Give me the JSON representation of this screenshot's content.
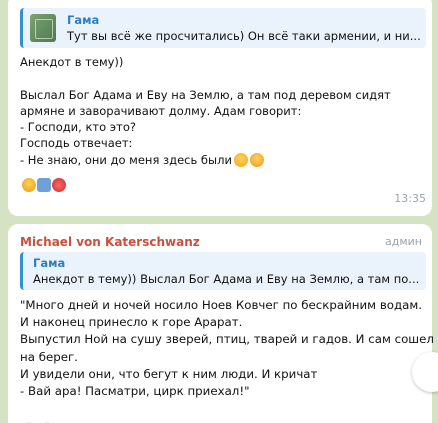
{
  "message1": {
    "reply": {
      "author": "Гама",
      "preview": "Тут вы всё же просчитались) Он всё таки армении, и ни..."
    },
    "text": "Анекдот в тему))\n\nВыслал Бог Адама и Еву на Землю, а там под деревом сидят\nармяне и заворачивают долму. Адам говорит:\n- Господи, кто это?\nГосподь отвечает:\n- Не знаю, они до меня здесь были",
    "inline_emoji": [
      "grinning-face-icon",
      "rofl-face-icon"
    ],
    "reactions": [
      "rofl-reaction-icon",
      "clapper-reaction-icon",
      "red-reaction-icon"
    ],
    "time": "13:35"
  },
  "message2": {
    "sender": "Michael von Katerschwanz",
    "role": "админ",
    "sender_color": "#c9503d",
    "reply": {
      "author": "Гама",
      "preview": "Анекдот в тему))  Выслал Бог Адама и Еву на Землю, а там по..."
    },
    "text": "\"Много дней и ночей носило Ноев Ковчег по бескрайним водам.\nИ наконец принесло к горе Арарат.\nВыпустил Ной на сушу зверей, птиц, тварей и гадов. И сам сошел\nна берег.\nИ увидели они, что бегут к ним люди. И кричат\n- Вай ара! Пасматри, цирк приехал!\""
  },
  "colors": {
    "background": "#d6e2c4",
    "bubble": "#ffffff",
    "accent": "#3390d4"
  }
}
